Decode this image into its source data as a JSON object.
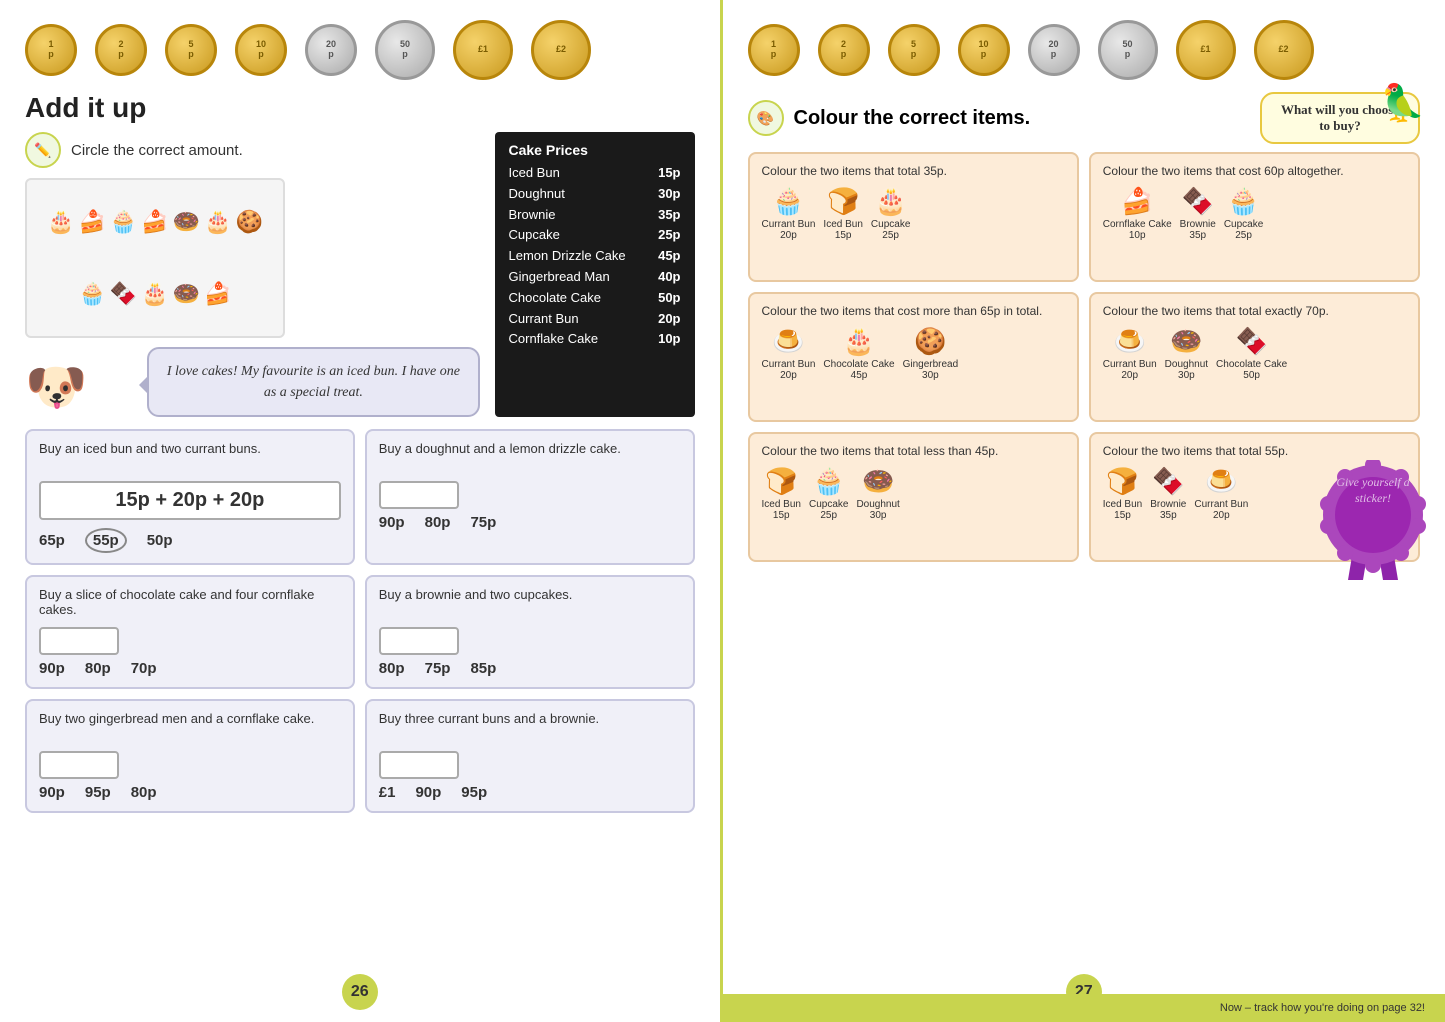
{
  "left": {
    "title": "Add it up",
    "instruction": "Circle the correct amount.",
    "speech_bubble": "I love cakes! My favourite is an iced bun. I have one as a special treat.",
    "price_list": {
      "title": "Cake Prices",
      "items": [
        {
          "name": "Iced Bun",
          "price": "15p"
        },
        {
          "name": "Doughnut",
          "price": "30p"
        },
        {
          "name": "Brownie",
          "price": "35p"
        },
        {
          "name": "Cupcake",
          "price": "25p"
        },
        {
          "name": "Lemon Drizzle Cake",
          "price": "45p"
        },
        {
          "name": "Gingerbread Man",
          "price": "40p"
        },
        {
          "name": "Chocolate Cake",
          "price": "50p"
        },
        {
          "name": "Currant Bun",
          "price": "20p"
        },
        {
          "name": "Cornflake Cake",
          "price": "10p"
        }
      ]
    },
    "exercises": [
      {
        "text": "Buy an iced bun and two currant buns.",
        "calculation": "15p + 20p + 20p",
        "options": [
          "65p",
          "55p",
          "50p"
        ],
        "circled": 1,
        "has_calc": true
      },
      {
        "text": "Buy a doughnut and a lemon drizzle cake.",
        "calculation": "",
        "options": [
          "90p",
          "80p",
          "75p"
        ],
        "circled": -1,
        "has_calc": false
      },
      {
        "text": "Buy a slice of chocolate cake and four cornflake cakes.",
        "calculation": "",
        "options": [
          "90p",
          "80p",
          "70p"
        ],
        "circled": -1,
        "has_calc": false
      },
      {
        "text": "Buy a brownie and two cupcakes.",
        "calculation": "",
        "options": [
          "80p",
          "75p",
          "85p"
        ],
        "circled": -1,
        "has_calc": false
      },
      {
        "text": "Buy two gingerbread men and a cornflake cake.",
        "calculation": "",
        "options": [
          "90p",
          "95p",
          "80p"
        ],
        "circled": -1,
        "has_calc": false
      },
      {
        "text": "Buy three currant buns and a brownie.",
        "calculation": "",
        "options": [
          "£1",
          "90p",
          "95p"
        ],
        "circled": -1,
        "has_calc": false
      }
    ],
    "page_number": "26"
  },
  "right": {
    "instruction": "Colour the correct items.",
    "bird_speech": "What will you choose to buy?",
    "colour_boxes": [
      {
        "text": "Colour the two items that total 35p.",
        "items": [
          {
            "icon": "🧁",
            "label": "Currant Bun\n20p"
          },
          {
            "icon": "🍞",
            "label": "Iced Bun\n15p"
          },
          {
            "icon": "🎂",
            "label": "Cupcake\n25p"
          }
        ]
      },
      {
        "text": "Colour the two items that cost 60p altogether.",
        "items": [
          {
            "icon": "🍰",
            "label": "Cornflake Cake\n10p"
          },
          {
            "icon": "🍫",
            "label": "Brownie\n35p"
          },
          {
            "icon": "🧁",
            "label": "Cupcake\n25p"
          }
        ]
      },
      {
        "text": "Colour the two items that cost more than 65p in total.",
        "items": [
          {
            "icon": "🍮",
            "label": "Currant Bun\n20p"
          },
          {
            "icon": "🎂",
            "label": "Chocolate Cake\n45p"
          },
          {
            "icon": "🍪",
            "label": "Gingerbread\n30p"
          }
        ]
      },
      {
        "text": "Colour the two items that total exactly 70p.",
        "items": [
          {
            "icon": "🍮",
            "label": "Currant Bun\n20p"
          },
          {
            "icon": "🍩",
            "label": "Doughnut\n30p"
          },
          {
            "icon": "🍰",
            "label": "Chocolate Cake\n50p"
          }
        ]
      },
      {
        "text": "Colour the two items that total less than 45p.",
        "items": [
          {
            "icon": "🍞",
            "label": "Iced Bun\n15p"
          },
          {
            "icon": "🧁",
            "label": "Cupcake\n25p"
          },
          {
            "icon": "🍩",
            "label": "Doughnut\n30p"
          }
        ]
      },
      {
        "text": "Colour the two items that total 55p.",
        "items": [
          {
            "icon": "🍞",
            "label": "Iced Bun\n15p"
          },
          {
            "icon": "🍫",
            "label": "Brownie\n35p"
          },
          {
            "icon": "🍮",
            "label": "Currant Bun\n20p"
          }
        ]
      }
    ],
    "sticker": "Give yourself a sticker!",
    "page_number": "27",
    "footer_text": "Now – track how you're doing on page 32!"
  },
  "coins": [
    {
      "value": "1p",
      "type": "gold"
    },
    {
      "value": "2p",
      "type": "gold"
    },
    {
      "value": "5p",
      "type": "gold"
    },
    {
      "value": "10p",
      "type": "gold"
    },
    {
      "value": "20p",
      "type": "silver"
    },
    {
      "value": "50p",
      "type": "silver"
    },
    {
      "value": "£1",
      "type": "gold"
    },
    {
      "value": "£2",
      "type": "gold"
    }
  ]
}
